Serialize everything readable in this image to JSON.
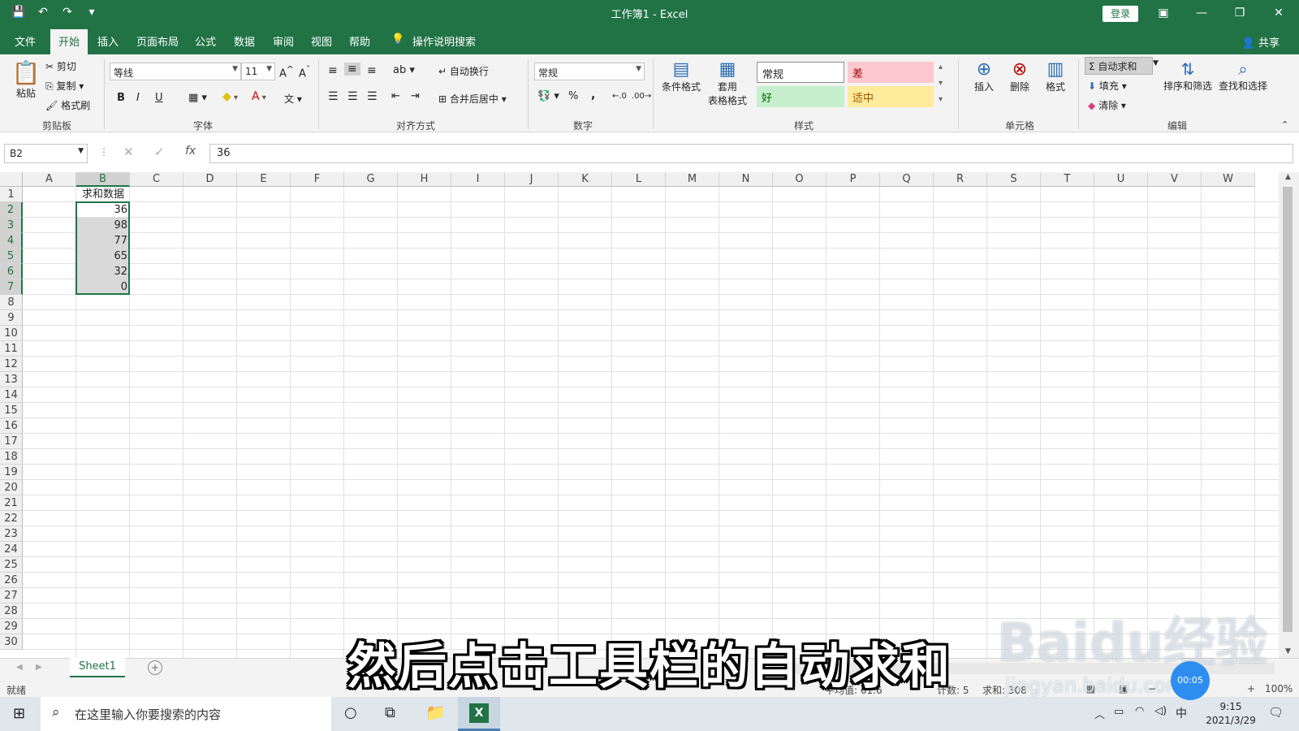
{
  "window": {
    "title": "工作簿1 - Excel",
    "login": "登录"
  },
  "menu": {
    "tabs": [
      "文件",
      "开始",
      "插入",
      "页面布局",
      "公式",
      "数据",
      "审阅",
      "视图",
      "帮助"
    ],
    "tell_me": "操作说明搜索",
    "share": "共享"
  },
  "ribbon": {
    "clipboard": {
      "paste": "粘贴",
      "cut": "剪切",
      "copy": "复制",
      "format_painter": "格式刷",
      "label": "剪贴板"
    },
    "font": {
      "name": "等线",
      "size": "11",
      "bold": "B",
      "italic": "I",
      "underline": "U",
      "label": "字体"
    },
    "alignment": {
      "wrap": "自动换行",
      "merge": "合并后居中",
      "label": "对齐方式"
    },
    "number": {
      "format": "常规",
      "percent": "%",
      "comma": ",",
      "label": "数字"
    },
    "styles": {
      "conditional": "条件格式",
      "table_line1": "套用",
      "table_line2": "表格格式",
      "normal": "常规",
      "bad": "差",
      "good": "好",
      "neutral": "适中",
      "label": "样式"
    },
    "cells": {
      "insert": "插入",
      "delete": "删除",
      "format": "格式",
      "label": "单元格"
    },
    "editing": {
      "autosum": "自动求和",
      "fill": "填充",
      "clear": "清除",
      "sort": "排序和筛选",
      "find": "查找和选择",
      "label": "编辑"
    }
  },
  "formula_bar": {
    "name_box": "B2",
    "fx": "fx",
    "value": "36"
  },
  "sheet": {
    "columns": [
      "A",
      "B",
      "C",
      "D",
      "E",
      "F",
      "G",
      "H",
      "I",
      "J",
      "K",
      "L",
      "M",
      "N",
      "O",
      "P",
      "Q",
      "R",
      "S",
      "T",
      "U",
      "V",
      "W"
    ],
    "row_count": 30,
    "header": "求和数据",
    "values": [
      "36",
      "98",
      "77",
      "65",
      "32",
      "0"
    ]
  },
  "tabs": {
    "sheet1": "Sheet1",
    "add": "+"
  },
  "status": {
    "ready": "就绪",
    "average": "平均值: 61.6",
    "count": "计数: 5",
    "sum": "求和: 308",
    "zoom": "100%"
  },
  "taskbar": {
    "search_placeholder": "在这里输入你要搜索的内容",
    "ime": "中",
    "time": "9:15",
    "date": "2021/3/29"
  },
  "caption": "然后点击工具栏的自动求和",
  "watermark": "Baidu经验",
  "watermark_sub": "jingyan.baidu.com",
  "timer": "00:05",
  "colors": {
    "excel_green": "#217346",
    "selection_fill": "#d9d9d9"
  }
}
